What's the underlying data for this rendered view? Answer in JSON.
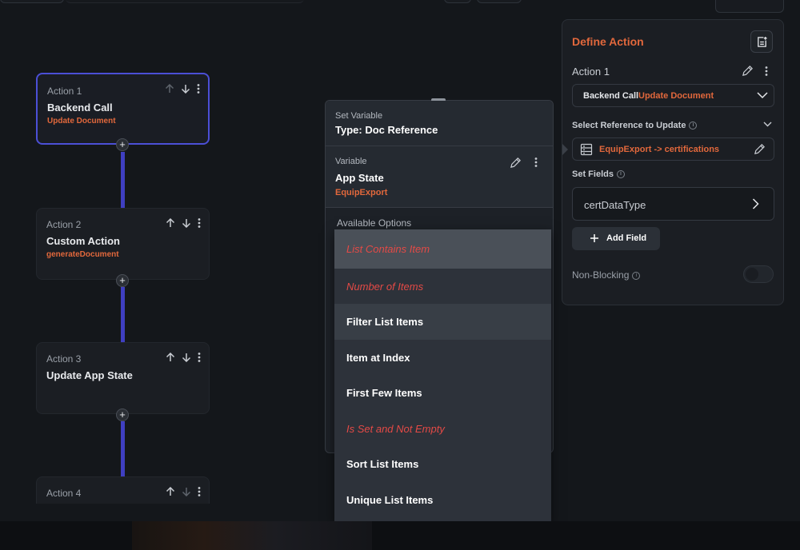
{
  "canvas": {
    "actions": [
      {
        "number_label": "Action 1",
        "title": "Backend Call",
        "subtitle": "Update Document"
      },
      {
        "number_label": "Action 2",
        "title": "Custom Action",
        "subtitle": "generateDocument"
      },
      {
        "number_label": "Action 3",
        "title": "Update App State",
        "subtitle": ""
      },
      {
        "number_label": "Action 4",
        "title": "",
        "subtitle": ""
      }
    ],
    "add_symbol": "+"
  },
  "variable_panel": {
    "header_label": "Set Variable",
    "header_type": "Type: Doc Reference",
    "variable_label": "Variable",
    "variable_source": "App State",
    "variable_name": "EquipExport",
    "available_options_label": "Available Options",
    "options": [
      {
        "label": "List Contains Item",
        "disabled": true
      },
      {
        "label": "Number of Items",
        "disabled": true
      },
      {
        "label": "Filter List Items",
        "disabled": false
      },
      {
        "label": "Item at Index",
        "disabled": false
      },
      {
        "label": "First Few Items",
        "disabled": false
      },
      {
        "label": "Is Set and Not Empty",
        "disabled": true
      },
      {
        "label": "Sort List Items",
        "disabled": false
      },
      {
        "label": "Unique List Items",
        "disabled": false
      }
    ]
  },
  "define_action": {
    "title": "Define Action",
    "action_name": "Action 1",
    "action_type": "Backend Call",
    "action_subtype": "Update Document",
    "reference_label": "Select Reference to Update",
    "reference_value": "EquipExport -> certifications",
    "set_fields_label": "Set Fields",
    "field_name": "certDataType",
    "add_field_label": "Add Field",
    "non_blocking_label": "Non-Blocking",
    "non_blocking_enabled": false
  },
  "colors": {
    "accent": "#e2683c",
    "connector": "#3f3fc1",
    "selected_border": "#4b4fd6",
    "disabled_option": "#e44a46"
  }
}
